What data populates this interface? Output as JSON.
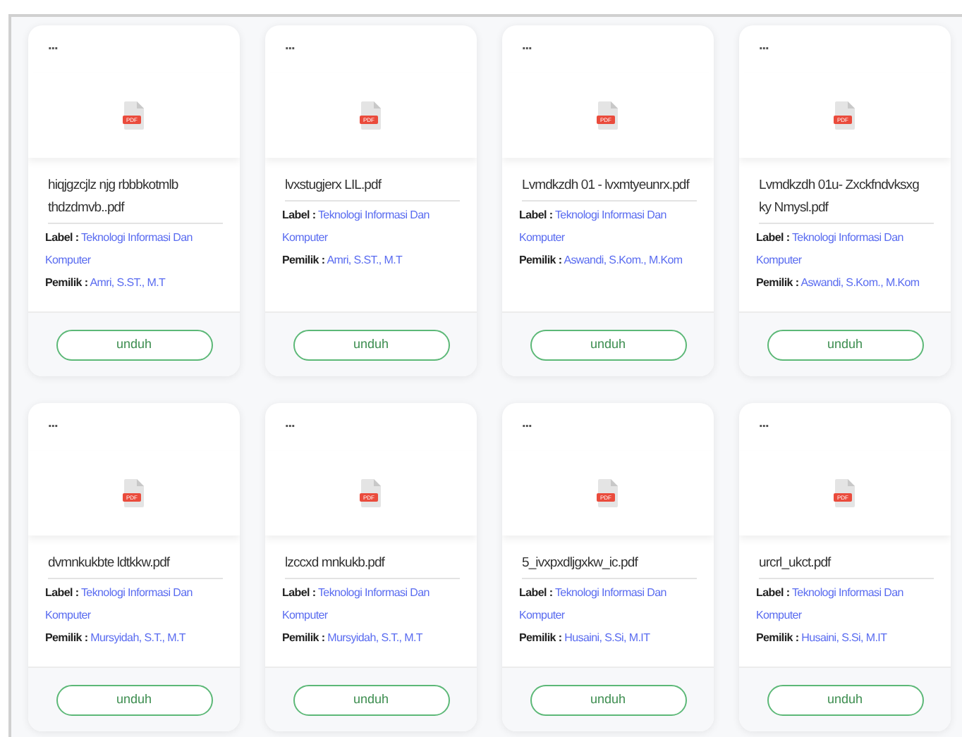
{
  "files": [
    {
      "menu": "...",
      "icon_text": "PDF",
      "name": "hiqjgzcjlz njg rbbbkotmlb thdzdmvb..pdf",
      "label_key": "Label :",
      "label": "Teknologi Informasi Dan Komputer",
      "owner_key": "Pemilik :",
      "owner": "Amri, S.ST., M.T",
      "button": "unduh"
    },
    {
      "menu": "...",
      "icon_text": "PDF",
      "name": "lvxstugjerx LIL.pdf",
      "label_key": "Label :",
      "label": "Teknologi Informasi Dan Komputer",
      "owner_key": "Pemilik :",
      "owner": "Amri, S.ST., M.T",
      "button": "unduh"
    },
    {
      "menu": "...",
      "icon_text": "PDF",
      "name": "Lvmdkzdh 01 - lvxmtyeunrx.pdf",
      "label_key": "Label :",
      "label": "Teknologi Informasi Dan Komputer",
      "owner_key": "Pemilik :",
      "owner": "Aswandi, S.Kom., M.Kom",
      "button": "unduh"
    },
    {
      "menu": "...",
      "icon_text": "PDF",
      "name": "Lvmdkzdh 01u- Zxckfndvksxg ky Nmysl.pdf",
      "label_key": "Label :",
      "label": "Teknologi Informasi Dan Komputer",
      "owner_key": "Pemilik :",
      "owner": "Aswandi, S.Kom., M.Kom",
      "button": "unduh"
    },
    {
      "menu": "...",
      "icon_text": "PDF",
      "name": "dvmnkukbte ldtkkw.pdf",
      "label_key": "Label :",
      "label": "Teknologi Informasi Dan Komputer",
      "owner_key": "Pemilik :",
      "owner": "Mursyidah, S.T., M.T",
      "button": "unduh"
    },
    {
      "menu": "...",
      "icon_text": "PDF",
      "name": "lzccxd mnkukb.pdf",
      "label_key": "Label :",
      "label": "Teknologi Informasi Dan Komputer",
      "owner_key": "Pemilik :",
      "owner": "Mursyidah, S.T., M.T",
      "button": "unduh"
    },
    {
      "menu": "...",
      "icon_text": "PDF",
      "name": "5_ivxpxdljgxkw_ic.pdf",
      "label_key": "Label :",
      "label": "Teknologi Informasi Dan Komputer",
      "owner_key": "Pemilik :",
      "owner": "Husaini, S.Si, M.IT",
      "button": "unduh"
    },
    {
      "menu": "...",
      "icon_text": "PDF",
      "name": "urcrl_ukct.pdf",
      "label_key": "Label :",
      "label": "Teknologi Informasi Dan Komputer",
      "owner_key": "Pemilik :",
      "owner": "Husaini, S.Si, M.IT",
      "button": "unduh"
    }
  ]
}
